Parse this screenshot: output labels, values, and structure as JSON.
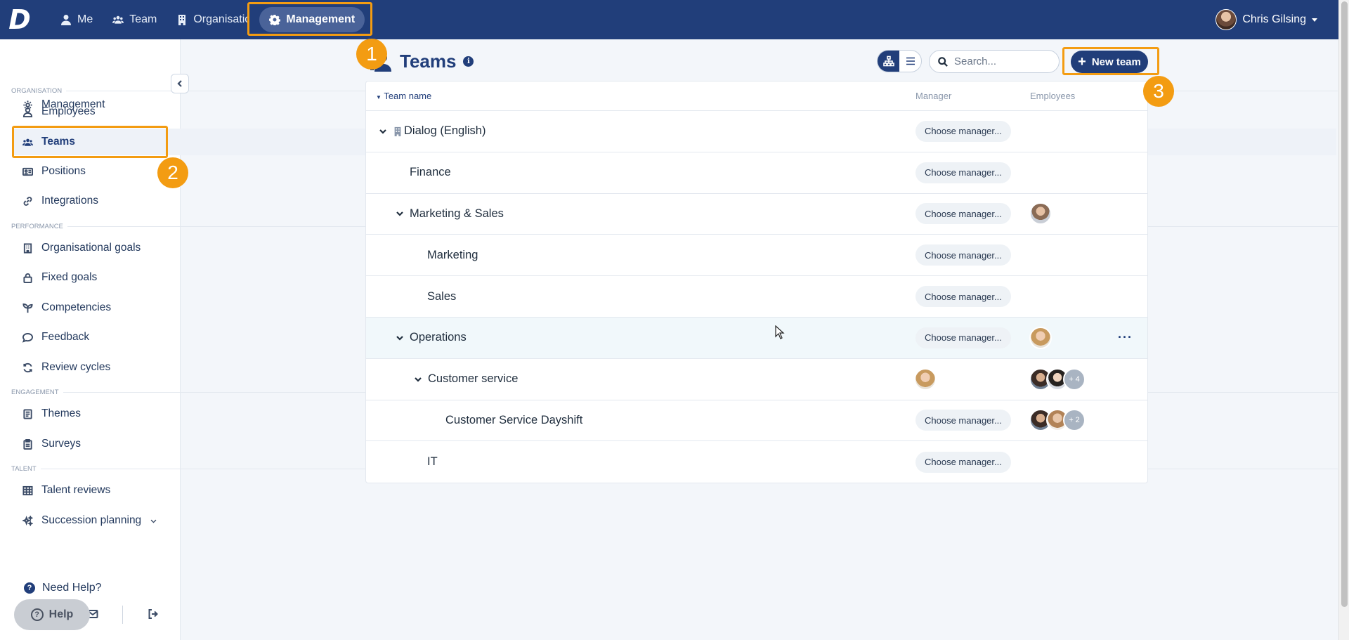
{
  "topbar": {
    "logo": "D",
    "nav": [
      {
        "label": "Me",
        "icon": "user-icon"
      },
      {
        "label": "Team",
        "icon": "users-icon"
      },
      {
        "label": "Organisation",
        "icon": "building-icon"
      },
      {
        "label": "Management",
        "icon": "gear-icon",
        "active": true
      }
    ],
    "user_name": "Chris Gilsing"
  },
  "sidebar": {
    "top_item": "Management",
    "sections": {
      "organisation": "ORGANISATION",
      "performance": "PERFORMANCE",
      "engagement": "ENGAGEMENT",
      "talent": "TALENT"
    },
    "items": {
      "employees": "Employees",
      "teams": "Teams",
      "positions": "Positions",
      "integrations": "Integrations",
      "organisational_goals": "Organisational goals",
      "fixed_goals": "Fixed goals",
      "competencies": "Competencies",
      "feedback": "Feedback",
      "review_cycles": "Review cycles",
      "themes": "Themes",
      "surveys": "Surveys",
      "talent_reviews": "Talent reviews",
      "succession_planning": "Succession planning"
    },
    "need_help": "Need Help?",
    "help_button": "Help"
  },
  "main": {
    "title": "Teams",
    "search_placeholder": "Search...",
    "new_team": "New team",
    "columns": {
      "name": "Team name",
      "manager": "Manager",
      "employees": "Employees"
    },
    "choose_manager": "Choose manager...",
    "rows": [
      {
        "name": "Dialog (English)",
        "level": 0,
        "expanded": true,
        "building": true
      },
      {
        "name": "Finance",
        "level": 1
      },
      {
        "name": "Marketing & Sales",
        "level": 1,
        "expanded": true
      },
      {
        "name": "Marketing",
        "level": 2
      },
      {
        "name": "Sales",
        "level": 2
      },
      {
        "name": "Operations",
        "level": 1,
        "expanded": true
      },
      {
        "name": "Customer service",
        "level": 2,
        "expanded": true,
        "more": "+ 4"
      },
      {
        "name": "Customer Service Dayshift",
        "level": 3,
        "more": "+ 2"
      },
      {
        "name": "IT",
        "level": 2
      }
    ]
  },
  "annotations": [
    "1",
    "2",
    "3"
  ],
  "colors": {
    "brand": "#213e7a",
    "highlight": "#f39c12"
  }
}
